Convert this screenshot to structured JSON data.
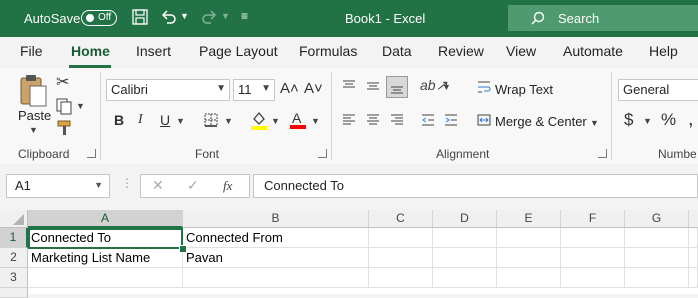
{
  "titlebar": {
    "autosave_label": "AutoSave",
    "autosave_state": "Off",
    "title": "Book1  -  Excel",
    "search_label": "Search"
  },
  "tabs": [
    "File",
    "Home",
    "Insert",
    "Page Layout",
    "Formulas",
    "Data",
    "Review",
    "View",
    "Automate",
    "Help"
  ],
  "active_tab": "Home",
  "ribbon": {
    "clipboard": {
      "paste_label": "Paste",
      "group_label": "Clipboard"
    },
    "font": {
      "font_name": "Calibri",
      "font_size": "11",
      "group_label": "Font",
      "grow_label": "A˄",
      "shrink_label": "A˅",
      "bold": "B",
      "italic": "I",
      "underline": "U"
    },
    "alignment": {
      "wrap_text": "Wrap Text",
      "merge_center": "Merge & Center",
      "group_label": "Alignment"
    },
    "number": {
      "format": "General",
      "currency": "$",
      "percent": "%",
      "group_label": "Numbe"
    }
  },
  "formula_bar": {
    "name_box": "A1",
    "fx_label": "fx",
    "content": "Connected To"
  },
  "grid": {
    "columns": [
      "A",
      "B",
      "C",
      "D",
      "E",
      "F",
      "G"
    ],
    "rows": [
      "1",
      "2",
      "3"
    ],
    "cells": {
      "A1": "Connected To",
      "B1": "Connected From",
      "A2": "Marketing List Name",
      "B2": "Pavan"
    },
    "selected_cell": "A1"
  },
  "colors": {
    "accent": "#217346",
    "search_bg": "#4f9a6e",
    "font_highlight": "#ffff00",
    "font_color": "#ff0000"
  }
}
